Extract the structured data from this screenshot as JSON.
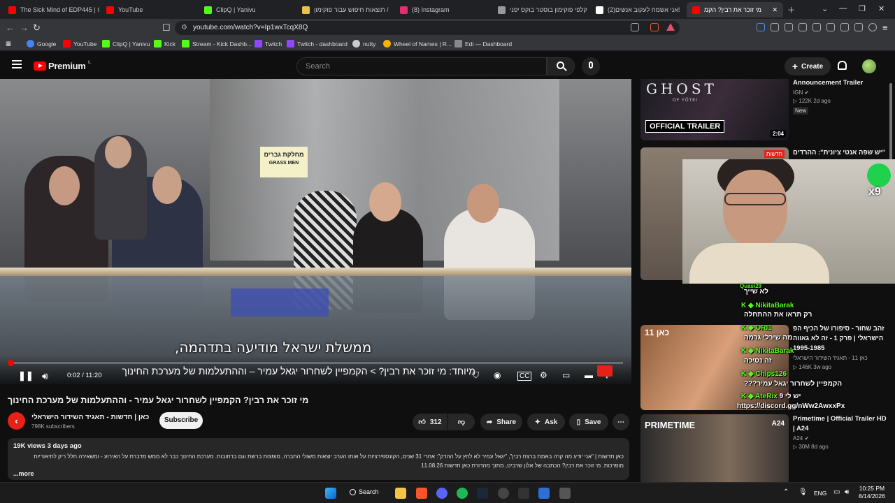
{
  "browser": {
    "tabs": [
      {
        "label": "The Sick Mind of EDP445 | Off",
        "color": "#ff0000"
      },
      {
        "label": "YouTube",
        "color": "#ff0000"
      },
      {
        "label": "ClipQ | Yanivu",
        "color": "#53fc18"
      },
      {
        "label": "תוצאות חיפוש עבור פוקימון /",
        "color": "#e8c14a"
      },
      {
        "label": "(8) Instagram",
        "color": "#e1306c"
      },
      {
        "label": "קלפי פוקימון בוסטר בוקס יפני",
        "color": "#999999"
      },
      {
        "label": "(2)אני אשמח לעקוב אנשים!",
        "color": "#ffffff"
      },
      {
        "label": "מי זוכר את רבין? הקמ",
        "color": "#ff0000"
      }
    ],
    "url": "youtube.com/watch?v=Ip1wxTcqX8Q",
    "bookmarks": [
      {
        "label": "Google",
        "color": "#4285f4"
      },
      {
        "label": "YouTube",
        "color": "#ff0000"
      },
      {
        "label": "ClipQ | Yanivu",
        "color": "#53fc18"
      },
      {
        "label": "Kick",
        "color": "#53fc18"
      },
      {
        "label": "Stream - Kick Dashb...",
        "color": "#53fc18"
      },
      {
        "label": "Twitch",
        "color": "#9146ff"
      },
      {
        "label": "Twitch - dashboard",
        "color": "#9146ff"
      },
      {
        "label": "nutty",
        "color": "#cccccc"
      },
      {
        "label": "Wheel of Names | R...",
        "color": "#f4b400"
      },
      {
        "label": "Edi — Dashboard",
        "color": "#888888"
      }
    ]
  },
  "header": {
    "logo": "Premium",
    "logo_region": "IL",
    "search_placeholder": "Search",
    "create_label": "Create"
  },
  "player": {
    "subtitle": "ממשלת ישראל מודיעה בתדהמה,",
    "time": "0:02 / 11:20",
    "chapter": "מיוחד: מי זוכר את רבין? > הקמפיין לשחרור יגאל עמיר – וההתעלמות של מערכת החינוך",
    "scene_sign": "מחלקת גברים",
    "scene_sign_en": "GRASS MEN",
    "progress": 0.003
  },
  "video": {
    "title": "מי זוכר את רבין? הקמפיין לשחרור יגאל עמיר - וההתעלמות של מערכת החינוך",
    "channel": "כאן | חדשות - תאגיד השידור הישראלי",
    "subscribers": "798K subscribers",
    "subscribe_label": "Subscribe",
    "likes": "312",
    "share_label": "Share",
    "ask_label": "Ask",
    "save_label": "Save",
    "views_date": "19K views  3 days ago",
    "description": "כאן חדשות | \"אני יודע מה קרה באמת ברצח רבין\", \"יגאל עמיר לא לחץ על ההדק\": אחרי 31 שנים, הקונספירציות על אותו הערב יוצאות משולי החברה, מופצות ברשת וגם ברחובות. מערכת החינוך כבר לא ממש מדברת על האירוע - ומשאירה חלל ריק לתיאוריות מופרכות. מי זוכר את רבין? הכתבה של אלון שרביט, מתוך מהדורת כאן חדשות 11.08.26",
    "more_label": "...more"
  },
  "sidebar": {
    "items": [
      {
        "title": "Announcement Trailer",
        "channel": "IGN",
        "meta": "122K  2d ago",
        "badge": "New",
        "thumb_text": "GHOST",
        "thumb_sub": "OF YŌTEI",
        "thumb_banner": "OFFICIAL TRAILER",
        "duration": "2:04"
      },
      {
        "title": "\"יש שפה אנטי ציונית\": ההרדים",
        "channel": "",
        "meta": "",
        "thumb_text": "חדשות"
      },
      {
        "title": "זהב שחור - סיפורו של הכיף הפ",
        "title2": "הישראלי | פרק 1 - זה לא גאווה",
        "title3": "1995-1985",
        "channel": "כאן 11 - תאגיד השידור הישראלי",
        "meta": "146K  3w ago",
        "thumb_text": "כאן 11"
      },
      {
        "title": "Primetime | Official Trailer HD",
        "title2": "| A24",
        "channel": "A24",
        "meta": "30M  8d ago",
        "thumb_text": "PRIMETIME",
        "thumb_badge": "A24"
      }
    ]
  },
  "overlay": {
    "chat": [
      {
        "name": "Quasi29",
        "text": "לא שייך",
        "color": "#53fc18"
      },
      {
        "name": "NikitaBarak",
        "text": "רק תראו את ההתחלה",
        "color": "#53fc18"
      },
      {
        "name": "ORI1",
        "text": "מה שירלי גרמה",
        "color": "#53fc18"
      },
      {
        "name": "NikitaBarak",
        "text": "זה נסיכה",
        "color": "#53fc18"
      },
      {
        "name": "Chips126",
        "text": "הקמפיין לשחרור יגאל עמיר???",
        "color": "#53fc18"
      },
      {
        "name": "AteRix",
        "text": "יש לי 9",
        "color": "#53fc18"
      }
    ],
    "link": "https://discord.gg/nWw2AwxxPx",
    "emote_count": "x9"
  },
  "taskbar": {
    "search_label": "Search",
    "language": "ENG",
    "time": "10:25 PM",
    "date": "8/14/2026"
  }
}
